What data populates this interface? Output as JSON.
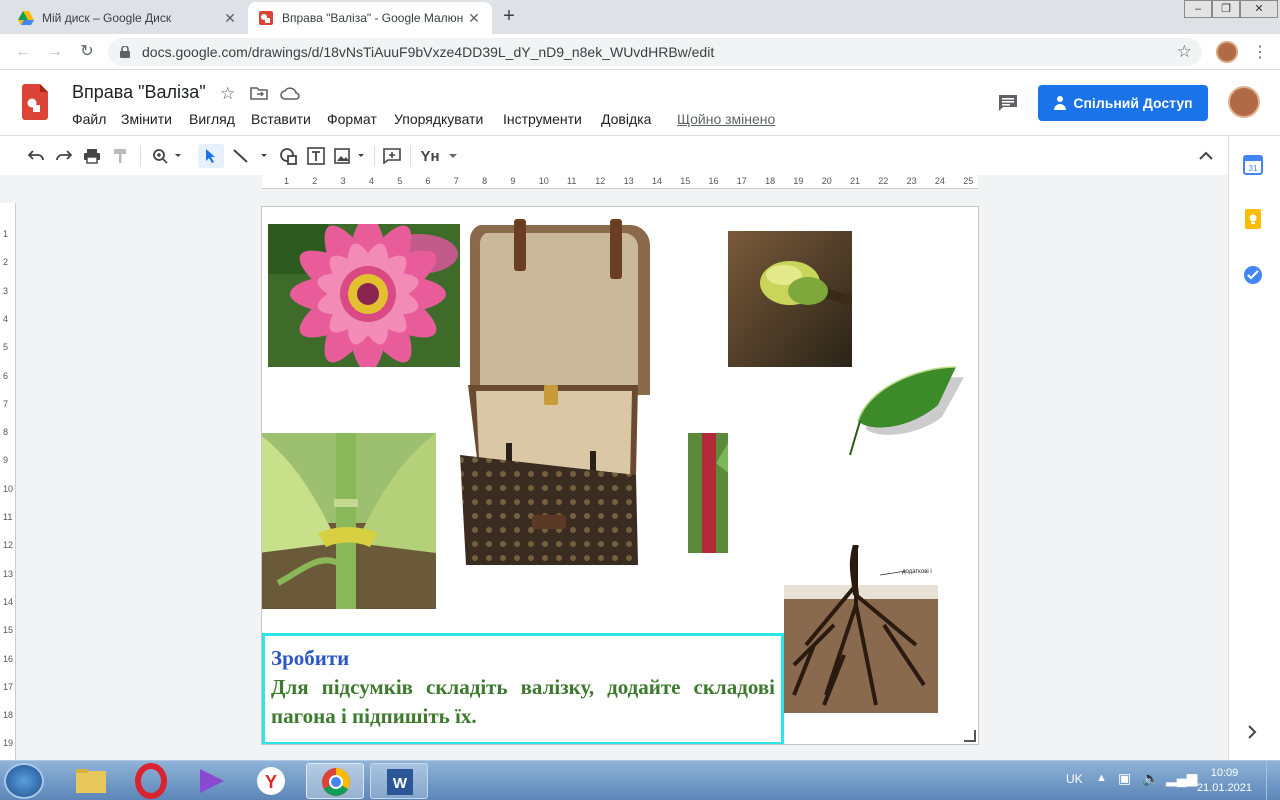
{
  "browser": {
    "tabs": [
      {
        "title": "Мій диск – Google Диск",
        "active": false
      },
      {
        "title": "Вправа \"Валіза\" - Google Малюн",
        "active": true
      }
    ],
    "url": "docs.google.com/drawings/d/18vNsTiAuuF9bVxze4DD39L_dY_nD9_n8ek_WUvdHRBw/edit"
  },
  "app": {
    "title": "Вправа \"Валіза\"",
    "menu": [
      "Файл",
      "Змінити",
      "Вигляд",
      "Вставити",
      "Формат",
      "Упорядкувати",
      "Інструменти",
      "Довідка"
    ],
    "last_edit": "Щойно змінено",
    "share_label": "Спільний Доступ",
    "toolbar_font_label": "Yн"
  },
  "ruler": {
    "h_ticks": [
      "1",
      "2",
      "3",
      "4",
      "5",
      "6",
      "7",
      "8",
      "9",
      "10",
      "11",
      "12",
      "13",
      "14",
      "15",
      "16",
      "17",
      "18",
      "19",
      "20",
      "21",
      "22",
      "23",
      "24",
      "25"
    ],
    "v_ticks": [
      "1",
      "2",
      "3",
      "4",
      "5",
      "6",
      "7",
      "8",
      "9",
      "10",
      "11",
      "12",
      "13",
      "14",
      "15",
      "16",
      "17",
      "18",
      "19"
    ]
  },
  "canvas": {
    "task_title": "Зробити",
    "task_text": "Для підсумків складіть валізку, додайте складові пагона і підпишіть їх.",
    "root_label": "додаткові і",
    "images": [
      "flower",
      "suitcase",
      "bud",
      "leaf",
      "corn-stem",
      "stem",
      "roots"
    ]
  },
  "taskbar": {
    "lang": "UK",
    "time": "10:09",
    "date": "21.01.2021"
  },
  "colors": {
    "accent": "#1a73e8",
    "textbox_border": "#2ee6e6",
    "task_title": "#2a56c6",
    "task_text": "#3d7a2e"
  }
}
